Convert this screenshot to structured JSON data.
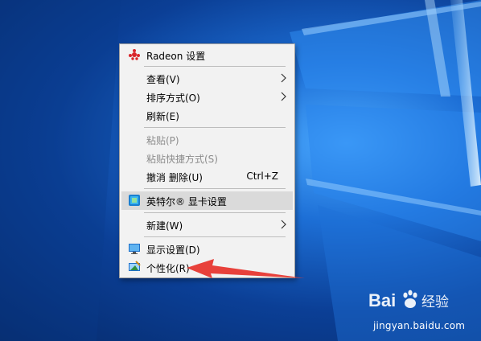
{
  "menu": {
    "items": [
      {
        "label": "Radeon 设置",
        "icon": "radeon-icon"
      },
      {
        "label": "查看(V)",
        "submenu": true
      },
      {
        "label": "排序方式(O)",
        "submenu": true
      },
      {
        "label": "刷新(E)"
      },
      {
        "label": "粘贴(P)",
        "disabled": true
      },
      {
        "label": "粘贴快捷方式(S)",
        "disabled": true
      },
      {
        "label": "撤消 删除(U)",
        "shortcut": "Ctrl+Z"
      },
      {
        "label": "英特尔® 显卡设置",
        "icon": "intel-graphics-icon",
        "highlighted": true
      },
      {
        "label": "新建(W)",
        "submenu": true
      },
      {
        "label": "显示设置(D)",
        "icon": "display-icon"
      },
      {
        "label": "个性化(R)",
        "icon": "personalize-icon"
      }
    ]
  },
  "annotation": {
    "arrow_color": "#e8413b"
  },
  "watermark": {
    "brand": "Baidu",
    "suffix": "经验",
    "url": "jingyan.baidu.com"
  },
  "colors": {
    "menu_bg": "#f2f2f2",
    "highlight": "#dadada",
    "disabled_text": "#8c8c8c",
    "desktop_blue": "#1d6fd6"
  }
}
